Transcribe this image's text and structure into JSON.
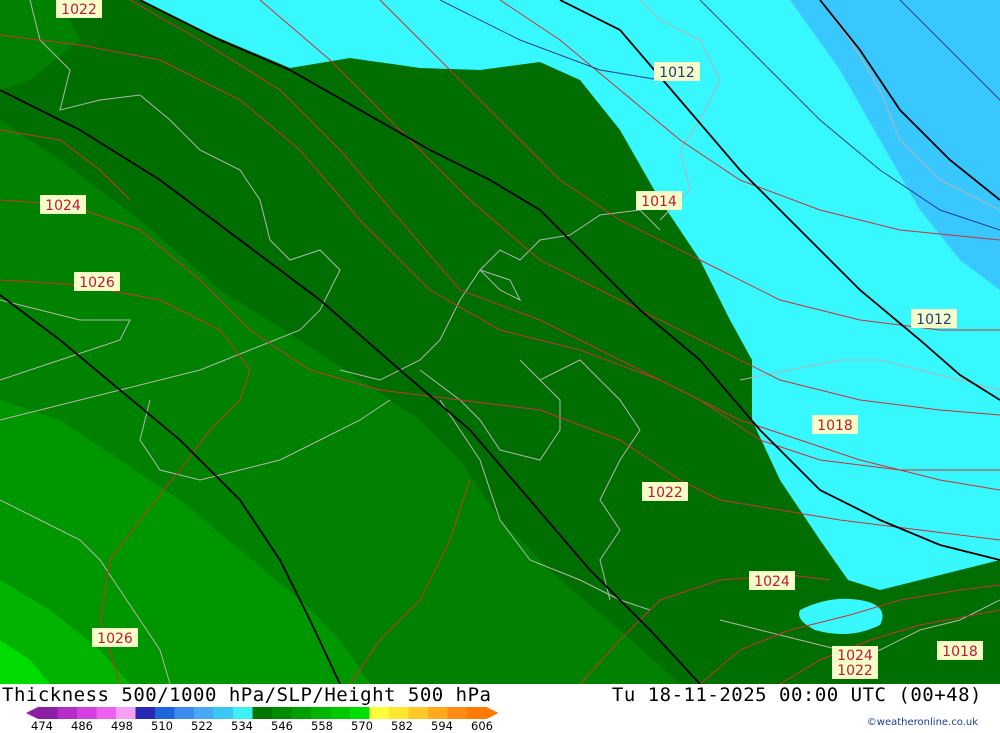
{
  "title": "Thickness 500/1000 hPa/SLP/Height 500 hPa",
  "valid_time": "Tu 18-11-2025 00:00 UTC (00+48)",
  "credit": "©weatheronline.co.uk",
  "colorbar": {
    "colors": [
      "#8c1fa6",
      "#b42dc8",
      "#d53ee0",
      "#f060f0",
      "#f5a0f5",
      "#2828b4",
      "#1e64dc",
      "#3c8cf0",
      "#46aaf5",
      "#3cc8f5",
      "#3cf0f5",
      "#007800",
      "#008c00",
      "#00a000",
      "#00b400",
      "#00c800",
      "#00e000",
      "#ffff3c",
      "#ffe632",
      "#ffc828",
      "#ffaa1e",
      "#ff8c14",
      "#ff7a00"
    ],
    "labels": [
      "474",
      "486",
      "498",
      "510",
      "522",
      "534",
      "546",
      "558",
      "570",
      "582",
      "594",
      "606"
    ]
  },
  "isobar_labels": [
    {
      "id": "slp-1022-nw",
      "text": "1022",
      "color": "#c8143c"
    },
    {
      "id": "slp-1012-n",
      "text": "1012",
      "color": "#1e3c8c"
    },
    {
      "id": "slp-1014",
      "text": "1014",
      "color": "#c8143c"
    },
    {
      "id": "slp-1024-w",
      "text": "1024",
      "color": "#c8143c"
    },
    {
      "id": "slp-1026-w",
      "text": "1026",
      "color": "#c8143c"
    },
    {
      "id": "slp-1012-e",
      "text": "1012",
      "color": "#1e3c8c"
    },
    {
      "id": "slp-1018-e",
      "text": "1018",
      "color": "#c8143c"
    },
    {
      "id": "slp-1022-c",
      "text": "1022",
      "color": "#c8143c"
    },
    {
      "id": "slp-1024-se",
      "text": "1024",
      "color": "#c8143c"
    },
    {
      "id": "slp-1026-sw",
      "text": "1026",
      "color": "#c8143c"
    },
    {
      "id": "slp-1024-s",
      "text": "1024",
      "color": "#c8143c"
    },
    {
      "id": "slp-1022-s",
      "text": "1022",
      "color": "#c8143c"
    },
    {
      "id": "slp-1018-se",
      "text": "1018",
      "color": "#c8143c"
    }
  ],
  "colors": {
    "thickness_528_534": "#006e00",
    "thickness_534_540": "#008200",
    "thickness_540_546": "#009600",
    "thickness_546_552": "#00aa00",
    "thickness_552_558": "#00be00",
    "thickness_558_564": "#00dc00",
    "thickness_522_528": "#38f8ff",
    "thickness_516_522": "#38c8ff",
    "isobar": "#c83232",
    "height_contour": "#000000",
    "coastline": "#b4b4b4"
  }
}
